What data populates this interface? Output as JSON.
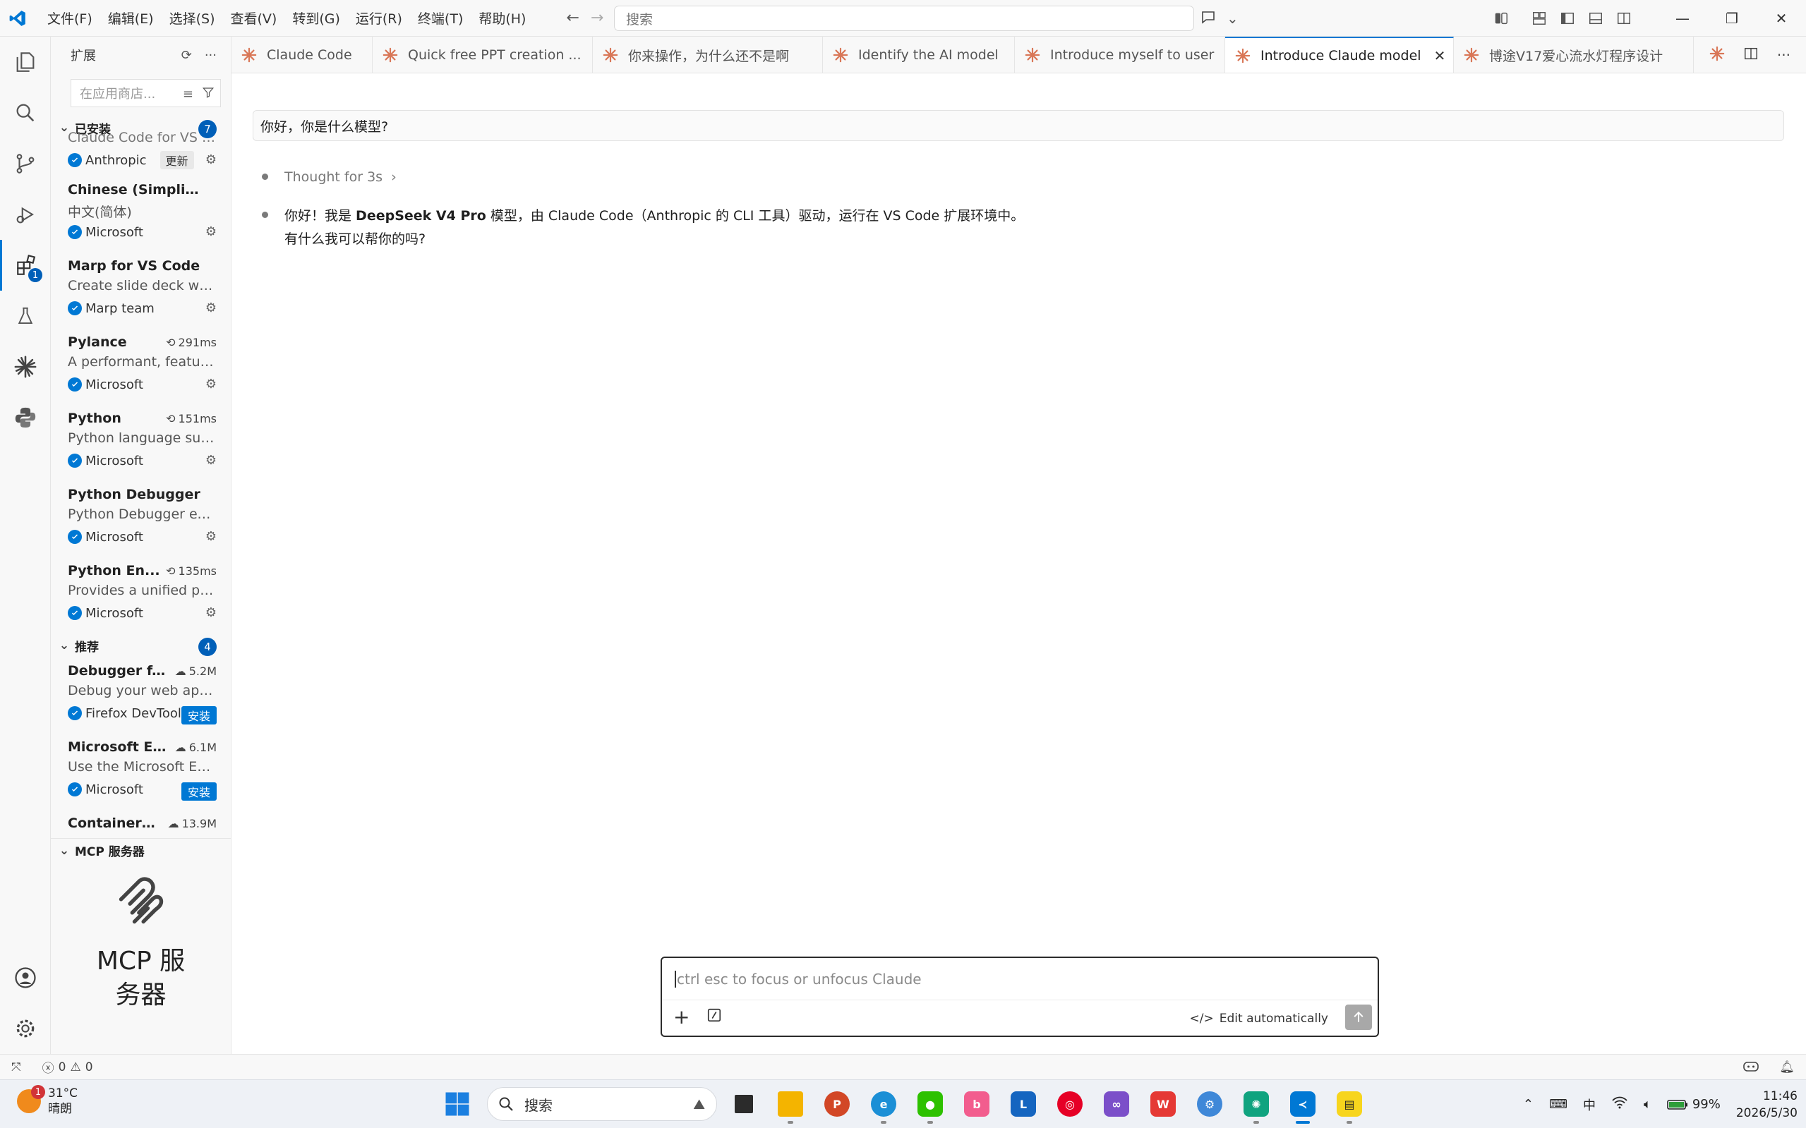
{
  "titlebar": {
    "menu": [
      "文件(F)",
      "编辑(E)",
      "选择(S)",
      "查看(V)",
      "转到(G)",
      "运行(R)",
      "终端(T)",
      "帮助(H)"
    ],
    "search_placeholder": "搜索"
  },
  "sidebar": {
    "title": "扩展",
    "search_placeholder": "在应用商店...",
    "installed": {
      "label": "已安装",
      "count": "7",
      "items": [
        {
          "name": "",
          "desc": "Claude Code for VS Co...",
          "publisher": "Anthropic",
          "meta": "",
          "action": "更新"
        },
        {
          "name": "Chinese (Simplified...",
          "desc": "中文(简体)",
          "publisher": "Microsoft",
          "meta": "",
          "action": ""
        },
        {
          "name": "Marp for VS Code",
          "desc": "Create slide deck writt...",
          "publisher": "Marp team",
          "meta": "",
          "action": ""
        },
        {
          "name": "Pylance",
          "desc": "A performant, feature-...",
          "publisher": "Microsoft",
          "meta": "291ms",
          "action": ""
        },
        {
          "name": "Python",
          "desc": "Python language supp...",
          "publisher": "Microsoft",
          "meta": "151ms",
          "action": ""
        },
        {
          "name": "Python Debugger",
          "desc": "Python Debugger exte...",
          "publisher": "Microsoft",
          "meta": "",
          "action": ""
        },
        {
          "name": "Python En...",
          "desc": "Provides a unified pyth...",
          "publisher": "Microsoft",
          "meta": "135ms",
          "action": ""
        }
      ]
    },
    "recommended": {
      "label": "推荐",
      "count": "4",
      "items": [
        {
          "name": "Debugger f...",
          "desc": "Debug your web appli...",
          "publisher": "Firefox DevTools",
          "meta": "5.2M",
          "action": "安装"
        },
        {
          "name": "Microsoft E...",
          "desc": "Use the Microsoft Edg...",
          "publisher": "Microsoft",
          "meta": "6.1M",
          "action": "安装"
        },
        {
          "name": "Container ...",
          "desc": "",
          "publisher": "",
          "meta": "13.9M",
          "action": ""
        }
      ]
    },
    "mcp": {
      "label": "MCP 服务器",
      "title_line1": "MCP 服",
      "title_line2": "务器"
    }
  },
  "tabs": [
    {
      "label": "Claude Code",
      "active": false
    },
    {
      "label": "Quick free PPT creation ...",
      "active": false
    },
    {
      "label": "你来操作，为什么还不是啊",
      "active": false
    },
    {
      "label": "Identify the AI model",
      "active": false
    },
    {
      "label": "Introduce myself to user",
      "active": false
    },
    {
      "label": "Introduce Claude model",
      "active": true
    },
    {
      "label": "博途V17爱心流水灯程序设计",
      "active": false
    }
  ],
  "chat": {
    "user_message": "你好，你是什么模型?",
    "thought": "Thought for 3s",
    "answer_prefix": "你好！我是 ",
    "answer_bold": "DeepSeek V4 Pro",
    "answer_suffix": " 模型，由 Claude Code（Anthropic 的 CLI 工具）驱动，运行在 VS Code 扩展环境中。",
    "answer_line2": "有什么我可以帮你的吗?",
    "input_placeholder": "ctrl esc to focus or unfocus Claude",
    "edit_mode": "Edit automatically"
  },
  "statusbar": {
    "errors": "0",
    "warnings": "0"
  },
  "taskbar": {
    "temperature": "31°C",
    "weather": "晴朗",
    "weather_badge": "1",
    "search_label": "搜索",
    "battery": "99%",
    "ime": "中",
    "time": "11:46",
    "date": "2026/5/30"
  },
  "colors": {
    "accent": "#0078d4",
    "claude_orange": "#d97757"
  }
}
